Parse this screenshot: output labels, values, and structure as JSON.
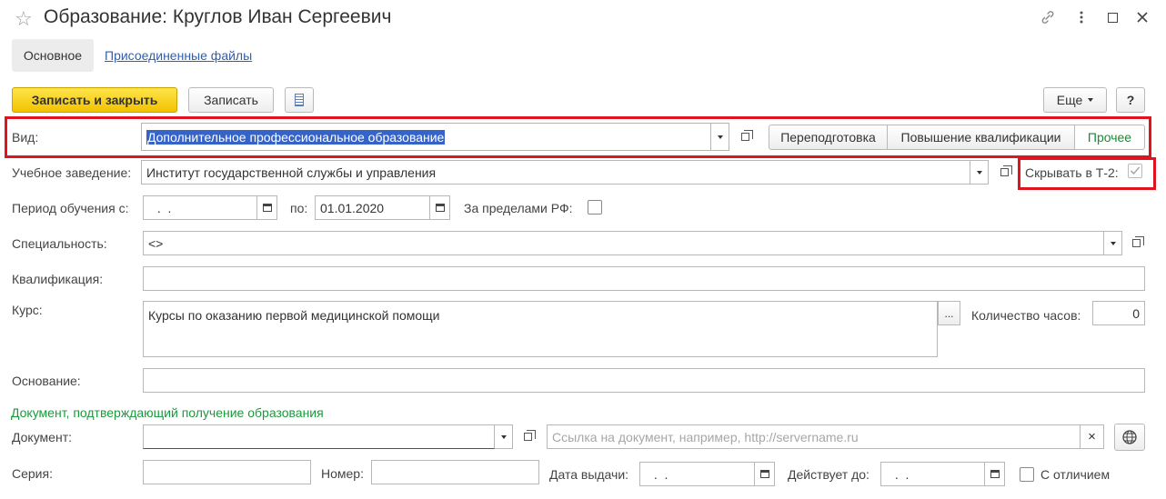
{
  "window": {
    "title": "Образование: Круглов Иван Сергеевич",
    "icons": [
      "star-icon",
      "link-icon",
      "more-vert-icon",
      "maximize-icon",
      "close-icon"
    ]
  },
  "tabs": {
    "main": "Основное",
    "files": "Присоединенные файлы"
  },
  "toolbar": {
    "save_close": "Записать и закрыть",
    "save": "Записать",
    "more": "Еще",
    "help": "?"
  },
  "form": {
    "vid": {
      "label": "Вид:",
      "value": "Дополнительное профессиональное образование"
    },
    "vid_buttons": [
      "Переподготовка",
      "Повышение квалификации",
      "Прочее"
    ],
    "institution": {
      "label": "Учебное заведение:",
      "value": "Институт государственной службы и управления"
    },
    "hide_t2": {
      "label": "Скрывать в Т-2:",
      "checked": true
    },
    "period": {
      "label": "Период обучения с:",
      "from": " .  .",
      "to_label": "по:",
      "to": "01.01.2020"
    },
    "abroad": {
      "label": "За пределами РФ:",
      "checked": false
    },
    "specialty": {
      "label": "Специальность:",
      "value": "<>"
    },
    "qualification": {
      "label": "Квалификация:",
      "value": ""
    },
    "course": {
      "label": "Курс:",
      "value": "Курсы по оказанию первой медицинской помощи",
      "ellipsis": "..."
    },
    "hours": {
      "label": "Количество часов:",
      "value": "0"
    },
    "basis": {
      "label": "Основание:",
      "value": ""
    }
  },
  "document_section": {
    "title": "Документ, подтверждающий получение образования",
    "document_label": "Документ:",
    "document_value": "",
    "link_placeholder": "Ссылка на документ, например, http://servername.ru",
    "clear": "×",
    "series_label": "Серия:",
    "number_label": "Номер:",
    "issue_label": "Дата выдачи:",
    "issue_value": " .  .",
    "valid_label": "Действует до:",
    "valid_value": " .  .",
    "honors_label": "С отличием",
    "honors_checked": false
  },
  "colors": {
    "primary_button": "#f2c200",
    "highlight": "#e0141e",
    "section_title": "#1b9a3c",
    "link": "#2f5fb0"
  }
}
